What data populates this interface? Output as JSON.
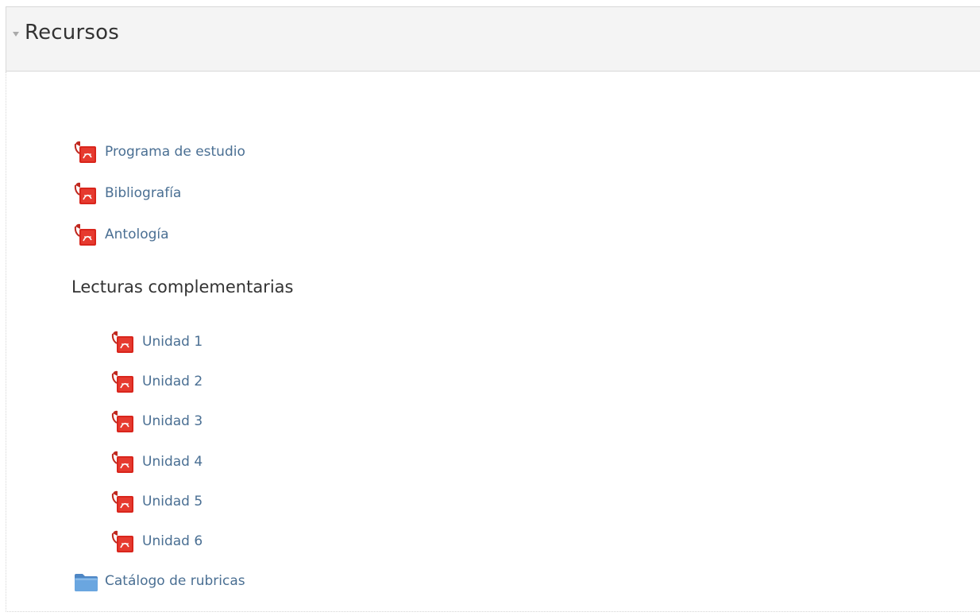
{
  "section": {
    "title": "Recursos",
    "collapse_icon": "triangle-down-icon"
  },
  "resources": [
    {
      "label": "Programa de estudio",
      "icon": "pdf-icon"
    },
    {
      "label": "Bibliografía",
      "icon": "pdf-icon"
    },
    {
      "label": "Antología",
      "icon": "pdf-icon"
    }
  ],
  "complementary": {
    "heading": "Lecturas complementarias",
    "items": [
      {
        "label": "Unidad 1",
        "icon": "pdf-icon"
      },
      {
        "label": "Unidad 2",
        "icon": "pdf-icon"
      },
      {
        "label": "Unidad 3",
        "icon": "pdf-icon"
      },
      {
        "label": "Unidad 4",
        "icon": "pdf-icon"
      },
      {
        "label": "Unidad 5",
        "icon": "pdf-icon"
      },
      {
        "label": "Unidad 6",
        "icon": "pdf-icon"
      }
    ]
  },
  "folder": {
    "label": "Catálogo de rubricas",
    "icon": "folder-icon"
  },
  "colors": {
    "link": "#4a6f93",
    "pdf_red": "#d9251c",
    "folder_blue": "#5e9ad6",
    "header_bg": "#f4f4f4"
  }
}
